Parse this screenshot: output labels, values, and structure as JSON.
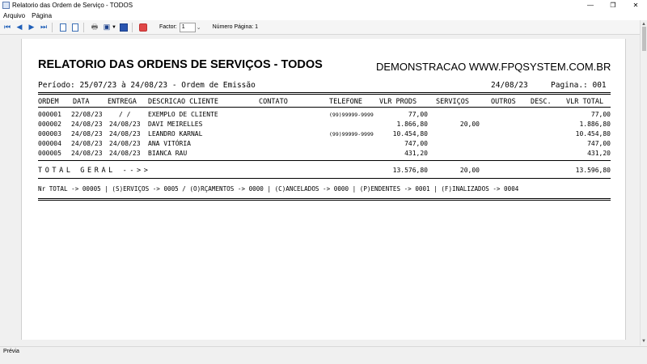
{
  "window": {
    "title": "Relatorio das Ordem de Serviço - TODOS",
    "controls": [
      "—",
      "❐",
      "✕"
    ]
  },
  "menu": {
    "items": [
      "Arquivo",
      "Página"
    ]
  },
  "toolbar": {
    "factor_label": "Factor:",
    "factor_value": "1",
    "page_number_label": "Número Página: 1"
  },
  "status": {
    "text": "Prévia"
  },
  "report": {
    "title": "RELATORIO DAS ORDENS DE SERVIÇOS - TODOS",
    "company": "DEMONSTRACAO WWW.FPQSYSTEM.COM.BR",
    "period": "Período: 25/07/23 à 24/08/23 - Ordem de Emissão",
    "print_date": "24/08/23",
    "page": "Pagina.: 001",
    "columns": {
      "ordem": "ORDEM",
      "data": "DATA",
      "entrega": "ENTREGA",
      "descricao": "DESCRICAO CLIENTE",
      "contato": "CONTATO",
      "telefone": "TELEFONE",
      "vlr_prods": "VLR PRODS",
      "servicos": "SERVIÇOS",
      "outros": "OUTROS",
      "desc": "DESC.",
      "vlr_total": "VLR TOTAL"
    },
    "rows": [
      {
        "ordem": "000001",
        "data": "22/08/23",
        "entrega": "/  /",
        "cliente": "EXEMPLO DE CLIENTE",
        "telefone": "(99)99999-9999",
        "vlr_prods": "77,00",
        "servicos": "",
        "vlr_total": "77,00"
      },
      {
        "ordem": "000002",
        "data": "24/08/23",
        "entrega": "24/08/23",
        "cliente": "DAVI MEIRELLES",
        "telefone": "",
        "vlr_prods": "1.866,80",
        "servicos": "20,00",
        "vlr_total": "1.886,80"
      },
      {
        "ordem": "000003",
        "data": "24/08/23",
        "entrega": "24/08/23",
        "cliente": "LEANDRO KARNAL",
        "telefone": "(99)99999-9999",
        "vlr_prods": "10.454,80",
        "servicos": "",
        "vlr_total": "10.454,80"
      },
      {
        "ordem": "000004",
        "data": "24/08/23",
        "entrega": "24/08/23",
        "cliente": "ANA VITÓRIA",
        "telefone": "",
        "vlr_prods": "747,00",
        "servicos": "",
        "vlr_total": "747,00"
      },
      {
        "ordem": "000005",
        "data": "24/08/23",
        "entrega": "24/08/23",
        "cliente": "BIANCA RAU",
        "telefone": "",
        "vlr_prods": "431,20",
        "servicos": "",
        "vlr_total": "431,20"
      }
    ],
    "total": {
      "label": "TOTAL GERAL -->>",
      "vlr_prods": "13.576,80",
      "servicos": "20,00",
      "vlr_total": "13.596,80"
    },
    "summary": "Nr TOTAL -> 00005 | (S)ERVIÇOS -> 0005 / (O)RÇAMENTOS -> 0000 | (C)ANCELADOS -> 0000 | (P)ENDENTES -> 0001 | (F)INALIZADOS -> 0004"
  },
  "icons": {
    "first_page": "first-page-icon",
    "prev_page": "prev-page-icon",
    "next_page": "next-page-icon",
    "last_page": "last-page-icon",
    "single_page": "single-page-icon",
    "two_pages": "two-pages-icon",
    "print": "print-icon",
    "save": "save-icon",
    "export": "export-icon",
    "close": "close-preview-icon"
  }
}
